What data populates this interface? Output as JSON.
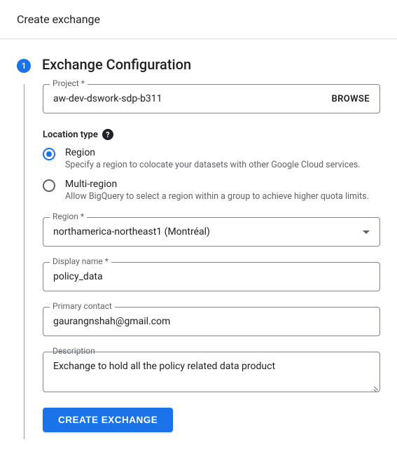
{
  "header": {
    "title": "Create exchange"
  },
  "step": {
    "number": "1",
    "title": "Exchange Configuration"
  },
  "project": {
    "label": "Project *",
    "value": "aw-dev-dswork-sdp-b311",
    "browse": "BROWSE"
  },
  "locationType": {
    "label": "Location type",
    "options": [
      {
        "title": "Region",
        "desc": "Specify a region to colocate your datasets with other Google Cloud services.",
        "selected": true
      },
      {
        "title": "Multi-region",
        "desc": "Allow BigQuery to select a region within a group to achieve higher quota limits.",
        "selected": false
      }
    ]
  },
  "region": {
    "label": "Region *",
    "value": "northamerica-northeast1 (Montréal)"
  },
  "displayName": {
    "label": "Display name *",
    "value": "policy_data"
  },
  "primaryContact": {
    "label": "Primary contact",
    "value": "gaurangnshah@gmail.com"
  },
  "description": {
    "label": "Description",
    "value": "Exchange to hold all the policy related data product"
  },
  "createButton": "CREATE EXCHANGE"
}
